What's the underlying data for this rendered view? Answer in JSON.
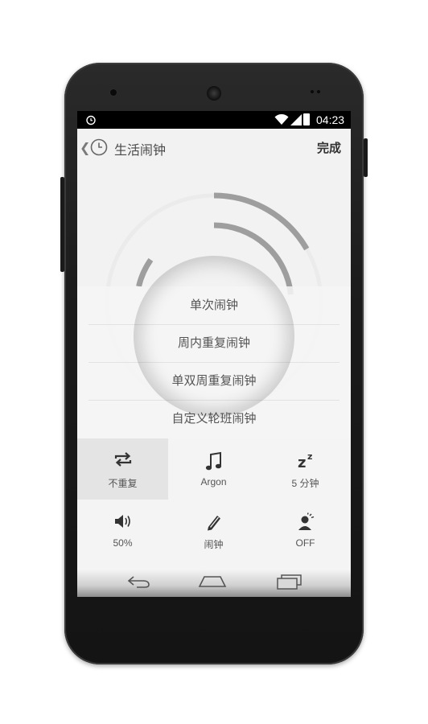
{
  "statusbar": {
    "time": "04:23",
    "icons": [
      "alarm-icon",
      "wifi-icon",
      "signal-icon",
      "battery-icon"
    ]
  },
  "appbar": {
    "back_icon": "chevron-left-icon",
    "app_icon": "clock-icon",
    "title": "生活闹钟",
    "done_label": "完成"
  },
  "alarm_types": [
    {
      "label": "单次闹钟"
    },
    {
      "label": "周内重复闹钟"
    },
    {
      "label": "单双周重复闹钟"
    },
    {
      "label": "自定义轮班闹钟"
    }
  ],
  "options": [
    {
      "label": "不重复",
      "icon": "repeat-icon",
      "selected": true
    },
    {
      "label": "Argon",
      "icon": "music-note-icon",
      "selected": false
    },
    {
      "label": "5 分钟",
      "icon": "snooze-icon",
      "selected": false
    },
    {
      "label": "50%",
      "icon": "volume-icon",
      "selected": false
    },
    {
      "label": "闹钟",
      "icon": "pencil-icon",
      "selected": false
    },
    {
      "label": "OFF",
      "icon": "wake-person-icon",
      "selected": false
    }
  ],
  "navbar": {
    "icons": [
      "back-icon",
      "home-icon",
      "recents-icon"
    ]
  },
  "colors": {
    "screen_bg": "#f2f2f2",
    "arc": "#9e9e9e",
    "text": "#555555",
    "selected_option": "#e4e4e4"
  }
}
